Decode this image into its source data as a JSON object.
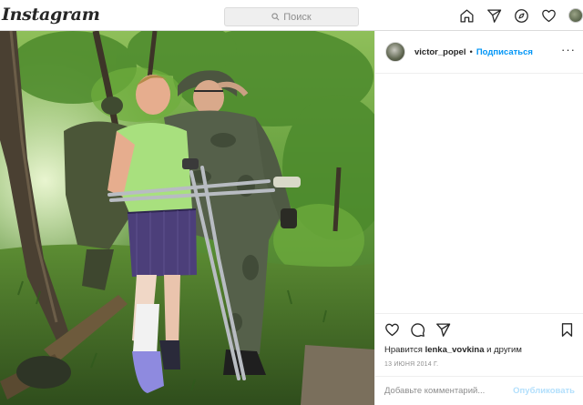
{
  "header": {
    "logo": "Instagram",
    "search_placeholder": "Поиск",
    "nav_icons": [
      "home-icon",
      "direct-icon",
      "explore-icon",
      "activity-icon",
      "profile-avatar"
    ]
  },
  "post": {
    "username": "victor_popel",
    "separator": "•",
    "follow_label": "Подписаться",
    "likes_prefix": "Нравится",
    "likes_user": "lenka_vovkina",
    "likes_suffix": "и другим",
    "date": "13 ИЮНЯ 2014 Г.",
    "comment_placeholder": "Добавьте комментарий...",
    "publish_label": "Опубликовать"
  },
  "colors": {
    "accent": "#0095f6",
    "publish_disabled": "#b2dffc",
    "text": "#262626",
    "muted": "#8e8e8e"
  }
}
